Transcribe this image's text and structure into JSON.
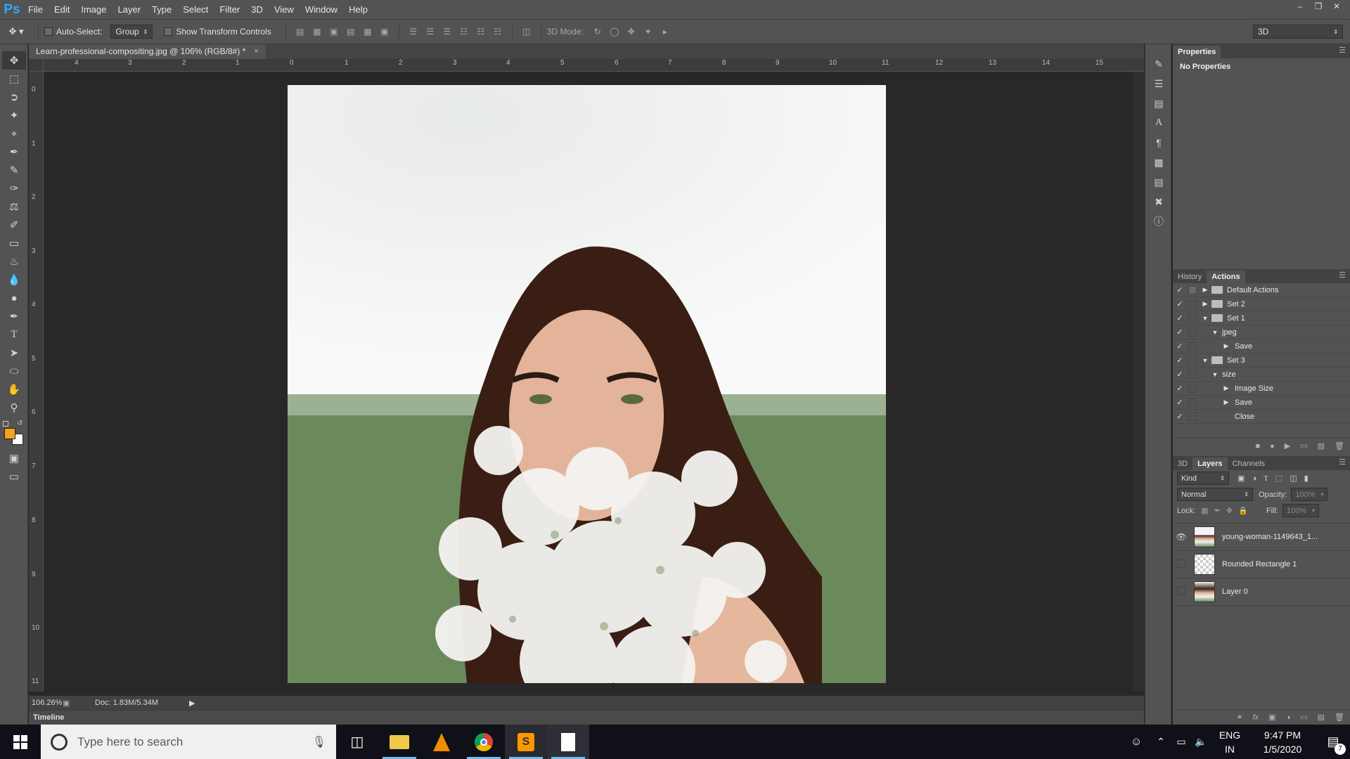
{
  "app": {
    "logo": "Ps"
  },
  "menu": [
    "File",
    "Edit",
    "Image",
    "Layer",
    "Type",
    "Select",
    "Filter",
    "3D",
    "View",
    "Window",
    "Help"
  ],
  "window_controls": [
    "minimize-icon",
    "restore-icon",
    "close-icon"
  ],
  "options": {
    "auto_select_label": "Auto-Select:",
    "auto_select_value": "Group",
    "transform_controls_label": "Show Transform Controls",
    "mode_3d_label": "3D Mode:",
    "workspace_value": "3D"
  },
  "document": {
    "tab_title": "Learn-professional-compositing.jpg @ 106% (RGB/8#) *",
    "close_glyph": "×",
    "zoom": "106.26%",
    "doc_info": "Doc: 1.83M/5.34M",
    "timeline_label": "Timeline"
  },
  "rulers": {
    "top": [
      "4",
      "3",
      "2",
      "1",
      "0",
      "1",
      "2",
      "3",
      "4",
      "5",
      "6",
      "7",
      "8",
      "9",
      "10",
      "11",
      "12",
      "13",
      "14",
      "15"
    ],
    "left": [
      "0",
      "1",
      "2",
      "3",
      "4",
      "5",
      "6",
      "7",
      "8",
      "9",
      "10",
      "11"
    ]
  },
  "properties": {
    "tab": "Properties",
    "message": "No Properties"
  },
  "actions_panel": {
    "tabs": [
      "History",
      "Actions"
    ],
    "active_tab": "Actions",
    "rows": [
      {
        "label": "Default Actions",
        "level": 0,
        "expanded": false,
        "folder": true
      },
      {
        "label": "Set 2",
        "level": 0,
        "expanded": false,
        "folder": true
      },
      {
        "label": "Set 1",
        "level": 0,
        "expanded": true,
        "folder": true
      },
      {
        "label": "jpeg",
        "level": 1,
        "expanded": true,
        "folder": false
      },
      {
        "label": "Save",
        "level": 2,
        "expanded": false,
        "folder": false
      },
      {
        "label": "Set 3",
        "level": 0,
        "expanded": true,
        "folder": true
      },
      {
        "label": "size",
        "level": 1,
        "expanded": true,
        "folder": false
      },
      {
        "label": "Image Size",
        "level": 2,
        "expanded": false,
        "folder": false
      },
      {
        "label": "Save",
        "level": 2,
        "expanded": false,
        "folder": false
      },
      {
        "label": "Close",
        "level": 2,
        "expanded": false,
        "folder": false,
        "no_triangle": true
      }
    ]
  },
  "layers_panel": {
    "tabs": [
      "3D",
      "Layers",
      "Channels"
    ],
    "active_tab": "Layers",
    "filter_kind": "Kind",
    "blend_mode": "Normal",
    "opacity_label": "Opacity:",
    "opacity_value": "100%",
    "lock_label": "Lock:",
    "fill_label": "Fill:",
    "fill_value": "100%",
    "layers": [
      {
        "name": "young-woman-1149643_1...",
        "visible": true
      },
      {
        "name": "Rounded Rectangle 1",
        "visible": false
      },
      {
        "name": "Layer 0",
        "visible": false
      }
    ]
  },
  "taskbar": {
    "search_placeholder": "Type here to search",
    "language": "ENG",
    "region": "IN",
    "time": "9:47 PM",
    "date": "1/5/2020",
    "notification_count": "7"
  },
  "colors": {
    "foreground": "#f5a31a",
    "background": "#ffffff",
    "ps_blue": "#31a8ff"
  }
}
